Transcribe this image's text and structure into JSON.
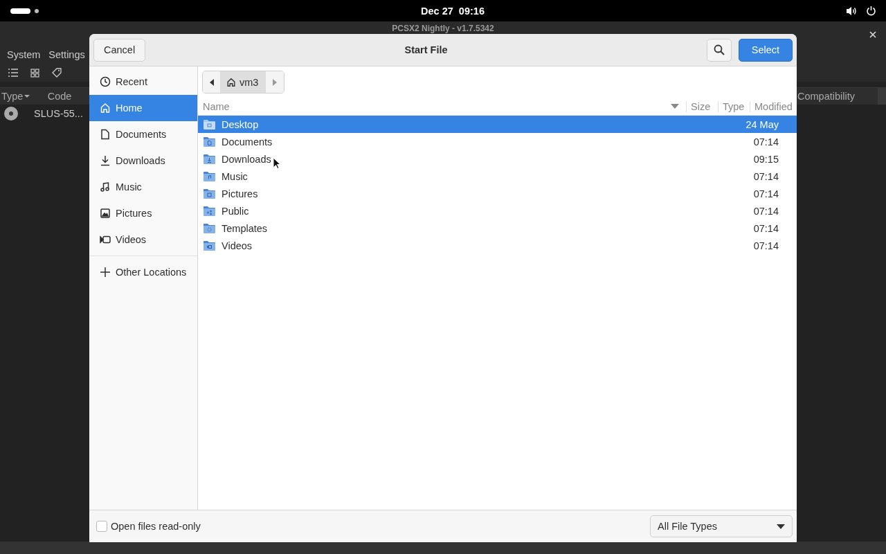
{
  "top_bar": {
    "clock": "Dec 27  09:16"
  },
  "background_window": {
    "title": "PCSX2 Nightly - v1.7.5342",
    "menu": [
      "System",
      "Settings"
    ],
    "columns": [
      "Type",
      "Code",
      "Compatibility"
    ],
    "rows": [
      {
        "code": "SLUS-55..."
      }
    ]
  },
  "dialog": {
    "title": "Start File",
    "cancel": "Cancel",
    "select": "Select",
    "sidebar": [
      {
        "kind": "recent",
        "label": "Recent",
        "selected": false
      },
      {
        "kind": "home",
        "label": "Home",
        "selected": true
      },
      {
        "kind": "documents",
        "label": "Documents",
        "selected": false
      },
      {
        "kind": "downloads",
        "label": "Downloads",
        "selected": false
      },
      {
        "kind": "music",
        "label": "Music",
        "selected": false
      },
      {
        "kind": "pictures",
        "label": "Pictures",
        "selected": false
      },
      {
        "kind": "videos",
        "label": "Videos",
        "selected": false
      }
    ],
    "other_locations": "Other Locations",
    "path": "vm3",
    "columns": [
      "Name",
      "Size",
      "Type",
      "Modified"
    ],
    "files": [
      {
        "kind": "desktop",
        "name": "Desktop",
        "modified": "24 May",
        "selected": true
      },
      {
        "kind": "documents",
        "name": "Documents",
        "modified": "07:14",
        "selected": false
      },
      {
        "kind": "downloads",
        "name": "Downloads",
        "modified": "09:15",
        "selected": false
      },
      {
        "kind": "music",
        "name": "Music",
        "modified": "07:14",
        "selected": false
      },
      {
        "kind": "pictures",
        "name": "Pictures",
        "modified": "07:14",
        "selected": false
      },
      {
        "kind": "public",
        "name": "Public",
        "modified": "07:14",
        "selected": false
      },
      {
        "kind": "templates",
        "name": "Templates",
        "modified": "07:14",
        "selected": false
      },
      {
        "kind": "videos",
        "name": "Videos",
        "modified": "07:14",
        "selected": false
      }
    ],
    "read_only": {
      "label": "Open files read-only",
      "checked": false
    },
    "filter": "All File Types"
  }
}
